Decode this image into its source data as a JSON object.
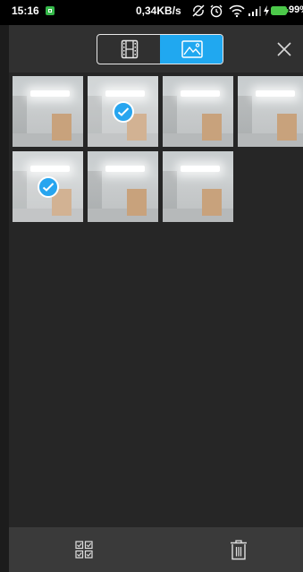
{
  "status_bar": {
    "time": "15:16",
    "net_speed": "0,34KB/s",
    "battery_percent": "99%",
    "icons": [
      "notification-icon",
      "data-sync-off-icon",
      "alarm-icon",
      "wifi-icon",
      "signal-icon",
      "charging-icon",
      "battery-icon"
    ]
  },
  "top_bar": {
    "modes": [
      {
        "name": "video",
        "icon": "film-strip-icon",
        "selected": false
      },
      {
        "name": "photo",
        "icon": "image-icon",
        "selected": true
      }
    ],
    "close_icon": "close-icon",
    "accent_color": "#20a8f0"
  },
  "gallery": {
    "thumbnails": [
      {
        "selected": false
      },
      {
        "selected": true
      },
      {
        "selected": false
      },
      {
        "selected": false
      },
      {
        "selected": true
      },
      {
        "selected": false
      },
      {
        "selected": false
      }
    ]
  },
  "bottom_bar": {
    "select_all_icon": "select-all-icon",
    "delete_icon": "trash-icon"
  }
}
